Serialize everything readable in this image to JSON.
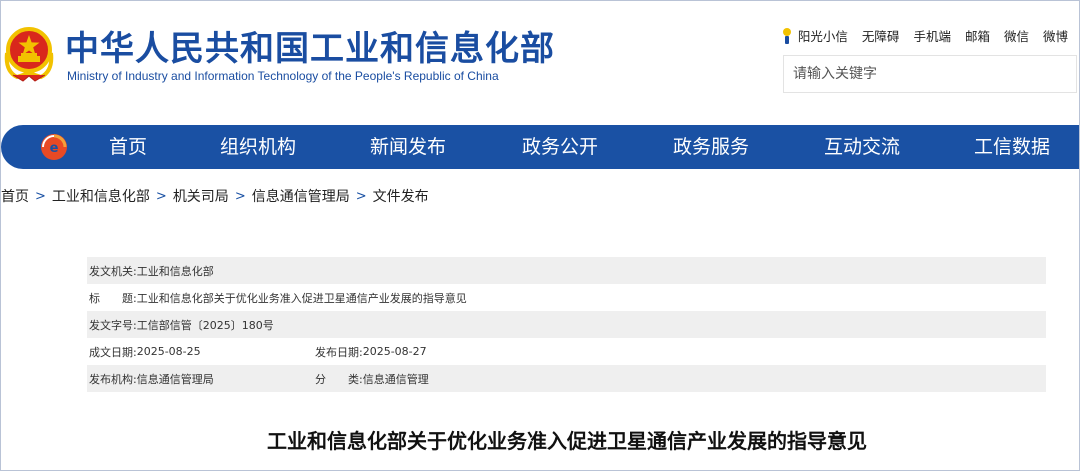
{
  "header": {
    "title_cn": "中华人民共和国工业和信息化部",
    "title_en": "Ministry of Industry and Information Technology of the People's Republic of China",
    "emblem_icon": "national-emblem-icon",
    "colors": {
      "brand_blue": "#1a4da1",
      "emblem_red": "#d9271c",
      "emblem_gold": "#f2c200"
    }
  },
  "top_links": {
    "sunshine": "阳光小信",
    "accessible": "无障碍",
    "mobile": "手机端",
    "mail": "邮箱",
    "wechat": "微信",
    "weibo": "微博"
  },
  "search": {
    "placeholder": "请输入关键字",
    "value": ""
  },
  "nav": {
    "logo_icon": "miit-logo-icon",
    "items": [
      "首页",
      "组织机构",
      "新闻发布",
      "政务公开",
      "政务服务",
      "互动交流",
      "工信数据"
    ],
    "color": "#1a51a4"
  },
  "breadcrumb": [
    "首页",
    "工业和信息化部",
    "机关司局",
    "信息通信管理局",
    "文件发布"
  ],
  "info": {
    "issuer_label": "发文机关:",
    "issuer": "工业和信息化部",
    "title_label": "标　　题:",
    "title": "工业和信息化部关于优化业务准入促进卫星通信产业发展的指导意见",
    "doc_no_label": "发文字号:",
    "doc_no": "工信部信管〔2025〕180号",
    "created_label": "成文日期:",
    "created": "2025-08-25",
    "published_label": "发布日期:",
    "published": "2025-08-27",
    "org_label": "发布机构:",
    "org": "信息通信管理局",
    "category_label": "分　　类:",
    "category": "信息通信管理"
  },
  "document_title": "工业和信息化部关于优化业务准入促进卫星通信产业发展的指导意见"
}
